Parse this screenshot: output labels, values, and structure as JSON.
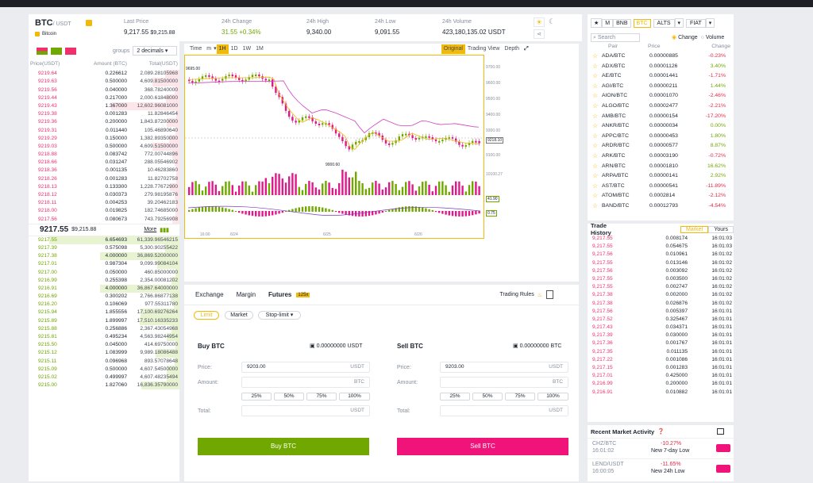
{
  "header": {
    "symbol": "BTC",
    "quote": "/ USDT",
    "coin_name": "Bitcoin",
    "stats": [
      {
        "label": "Last Price",
        "value": "9,217.55",
        "sub": "$9,215.88"
      },
      {
        "label": "24h Change",
        "value": "31.55 +0.34%"
      },
      {
        "label": "24h High",
        "value": "9,340.00"
      },
      {
        "label": "24h Low",
        "value": "9,091.55"
      },
      {
        "label": "24h Volume",
        "value": "423,180,135.02 USDT"
      }
    ]
  },
  "orderbook": {
    "groups_label": "groups",
    "groups_value": "2 decimals",
    "columns": [
      "Price(USDT)",
      "Amount (BTC)",
      "Total(USDT)"
    ],
    "asks": [
      [
        "9219.64",
        "0.226612",
        "2,089.28105968"
      ],
      [
        "9219.63",
        "0.500000",
        "4,609.81500000"
      ],
      [
        "9219.56",
        "0.040000",
        "368.78240000"
      ],
      [
        "9219.44",
        "0.217000",
        "2,000.61848000"
      ],
      [
        "9219.43",
        "1.367000",
        "12,602.96081000"
      ],
      [
        "9219.38",
        "0.001283",
        "11.82846454"
      ],
      [
        "9219.36",
        "0.200000",
        "1,843.87200000"
      ],
      [
        "9219.31",
        "0.011440",
        "105.46890640"
      ],
      [
        "9219.29",
        "0.150000",
        "1,382.89350000"
      ],
      [
        "9219.03",
        "0.500000",
        "4,609.51500000"
      ],
      [
        "9218.88",
        "0.083742",
        "772.00744896"
      ],
      [
        "9218.66",
        "0.031247",
        "288.05546902"
      ],
      [
        "9218.36",
        "0.001135",
        "10.46283860"
      ],
      [
        "9218.26",
        "0.001283",
        "11.82702758"
      ],
      [
        "9218.13",
        "0.133300",
        "1,228.77672900"
      ],
      [
        "9218.12",
        "0.030373",
        "279.98195876"
      ],
      [
        "9218.11",
        "0.004253",
        "39.20462183"
      ],
      [
        "9218.00",
        "0.019825",
        "182.74685000"
      ],
      [
        "9217.56",
        "0.080673",
        "743.79256908"
      ]
    ],
    "last_price": "9217.55",
    "last_usd": "$9,215.88",
    "more": "More",
    "bids": [
      [
        "9217.55",
        "6.654693",
        "61,339.96546215"
      ],
      [
        "9217.39",
        "0.575098",
        "5,300.90255422"
      ],
      [
        "9217.38",
        "4.000000",
        "36,869.52000000"
      ],
      [
        "9217.01",
        "0.987304",
        "9,099.99084104"
      ],
      [
        "9217.00",
        "0.050000",
        "460.85000000"
      ],
      [
        "9216.99",
        "0.255398",
        "2,354.00081202"
      ],
      [
        "9216.91",
        "4.000000",
        "36,867.64000000"
      ],
      [
        "9216.69",
        "0.300202",
        "2,766.86877138"
      ],
      [
        "9216.20",
        "0.106069",
        "977.55311780"
      ],
      [
        "9215.94",
        "1.855556",
        "17,100.69276264"
      ],
      [
        "9215.89",
        "1.899997",
        "17,510.16335233"
      ],
      [
        "9215.88",
        "0.256886",
        "2,367.43054968"
      ],
      [
        "9215.81",
        "0.495234",
        "4,563.98244954"
      ],
      [
        "9215.50",
        "0.045000",
        "414.69750000"
      ],
      [
        "9215.12",
        "1.083999",
        "9,989.18086488"
      ],
      [
        "9215.11",
        "0.096968",
        "893.57078648"
      ],
      [
        "9215.09",
        "0.500000",
        "4,607.54500000"
      ],
      [
        "9215.02",
        "0.499997",
        "4,607.48235494"
      ],
      [
        "9215.00",
        "1.827060",
        "16,836.35790000"
      ]
    ]
  },
  "chart": {
    "toolbar": [
      "Time",
      "m",
      "1H",
      "1D",
      "1W",
      "1M"
    ],
    "views": [
      "Original",
      "Trading View",
      "Depth"
    ],
    "price_labels": [
      "9700.00",
      "9600.00",
      "9500.00",
      "9400.00",
      "9300.00",
      "9200.00",
      "9100.00"
    ],
    "high_marker": "9695.00",
    "low_marker": "9000.60",
    "vol_label": "10100.27",
    "date_labels": [
      "16:00",
      "6/24",
      "6/25",
      "6/26"
    ],
    "ma_tags": [
      "9218.10",
      "41.90",
      "0.75"
    ]
  },
  "trade": {
    "tabs": [
      "Exchange",
      "Margin",
      "Futures"
    ],
    "futures_badge": "125x",
    "trading_rules": "Trading Rules",
    "order_types": [
      "Limit",
      "Market",
      "Stop-limit"
    ],
    "buy": {
      "title": "Buy BTC",
      "balance": "0.00000000 USDT",
      "price_label": "Price:",
      "price": "9203.00",
      "price_unit": "USDT",
      "amount_label": "Amount:",
      "amount_unit": "BTC",
      "total_label": "Total:",
      "total_unit": "USDT",
      "button": "Buy BTC"
    },
    "sell": {
      "title": "Sell BTC",
      "balance": "0.00000000 BTC",
      "price_label": "Price:",
      "price": "9203.00",
      "price_unit": "USDT",
      "amount_label": "Amount:",
      "amount_unit": "BTC",
      "total_label": "Total:",
      "total_unit": "USDT",
      "button": "Sell BTC"
    },
    "pcts": [
      "25%",
      "50%",
      "75%",
      "100%"
    ]
  },
  "markets": {
    "tabs": [
      "M",
      "BNB",
      "BTC",
      "ALTS",
      "FIAT"
    ],
    "search_placeholder": "Search",
    "radio": [
      "Change",
      "Volume"
    ],
    "columns": [
      "Pair",
      "Price",
      "Change"
    ],
    "rows": [
      [
        "ADA/BTC",
        "0.00000885",
        "-0.23%"
      ],
      [
        "ADX/BTC",
        "0.00001126",
        "3.40%"
      ],
      [
        "AE/BTC",
        "0.00001441",
        "-1.71%"
      ],
      [
        "AGI/BTC",
        "0.00000211",
        "1.44%"
      ],
      [
        "AION/BTC",
        "0.00001070",
        "-2.46%"
      ],
      [
        "ALGO/BTC",
        "0.00002477",
        "-2.21%"
      ],
      [
        "AMB/BTC",
        "0.00000154",
        "-17.20%"
      ],
      [
        "ANKR/BTC",
        "0.00000034",
        "0.00%"
      ],
      [
        "APPC/BTC",
        "0.00000453",
        "1.80%"
      ],
      [
        "ARDR/BTC",
        "0.00000577",
        "8.87%"
      ],
      [
        "ARK/BTC",
        "0.00003190",
        "-0.72%"
      ],
      [
        "ARN/BTC",
        "0.00001810",
        "16.62%"
      ],
      [
        "ARPA/BTC",
        "0.00000141",
        "2.92%"
      ],
      [
        "AST/BTC",
        "0.00000541",
        "-11.89%"
      ],
      [
        "ATOM/BTC",
        "0.0002814",
        "-2.12%"
      ],
      [
        "BAND/BTC",
        "0.00012793",
        "-4.54%"
      ]
    ]
  },
  "trade_history": {
    "title": "Trade History",
    "tabs": [
      "Market",
      "Yours"
    ],
    "rows": [
      [
        "9,217.55",
        "0.008174",
        "16:01:03"
      ],
      [
        "9,217.55",
        "0.054675",
        "16:01:03"
      ],
      [
        "9,217.56",
        "0.010961",
        "16:01:02"
      ],
      [
        "9,217.55",
        "0.013146",
        "16:01:02"
      ],
      [
        "9,217.56",
        "0.003092",
        "16:01:02"
      ],
      [
        "9,217.55",
        "0.003500",
        "16:01:02"
      ],
      [
        "9,217.55",
        "0.002747",
        "16:01:02"
      ],
      [
        "9,217.38",
        "0.002000",
        "16:01:02"
      ],
      [
        "9,217.38",
        "0.026876",
        "16:01:02"
      ],
      [
        "9,217.56",
        "0.005397",
        "16:01:01"
      ],
      [
        "9,217.52",
        "0.325467",
        "16:01:01"
      ],
      [
        "9,217.43",
        "0.034371",
        "16:01:01"
      ],
      [
        "9,217.39",
        "0.030000",
        "16:01:01"
      ],
      [
        "9,217.36",
        "0.001767",
        "16:01:01"
      ],
      [
        "9,217.35",
        "0.011135",
        "16:01:01"
      ],
      [
        "9,217.22",
        "0.001086",
        "16:01:01"
      ],
      [
        "9,217.15",
        "0.001283",
        "16:01:01"
      ],
      [
        "9,217.01",
        "0.425000",
        "16:01:01"
      ],
      [
        "9,216.99",
        "0.200000",
        "16:01:01"
      ],
      [
        "9,216.91",
        "0.010882",
        "16:01:01"
      ]
    ]
  },
  "activity": {
    "title": "Recent Market Activity",
    "items": [
      {
        "pair": "CHZ/BTC",
        "time": "16:01:02",
        "change": "-10.27%",
        "desc": "New 7-day Low"
      },
      {
        "pair": "LEND/USDT",
        "time": "16:00:05",
        "change": "-11.65%",
        "desc": "New 24h Low"
      }
    ]
  }
}
